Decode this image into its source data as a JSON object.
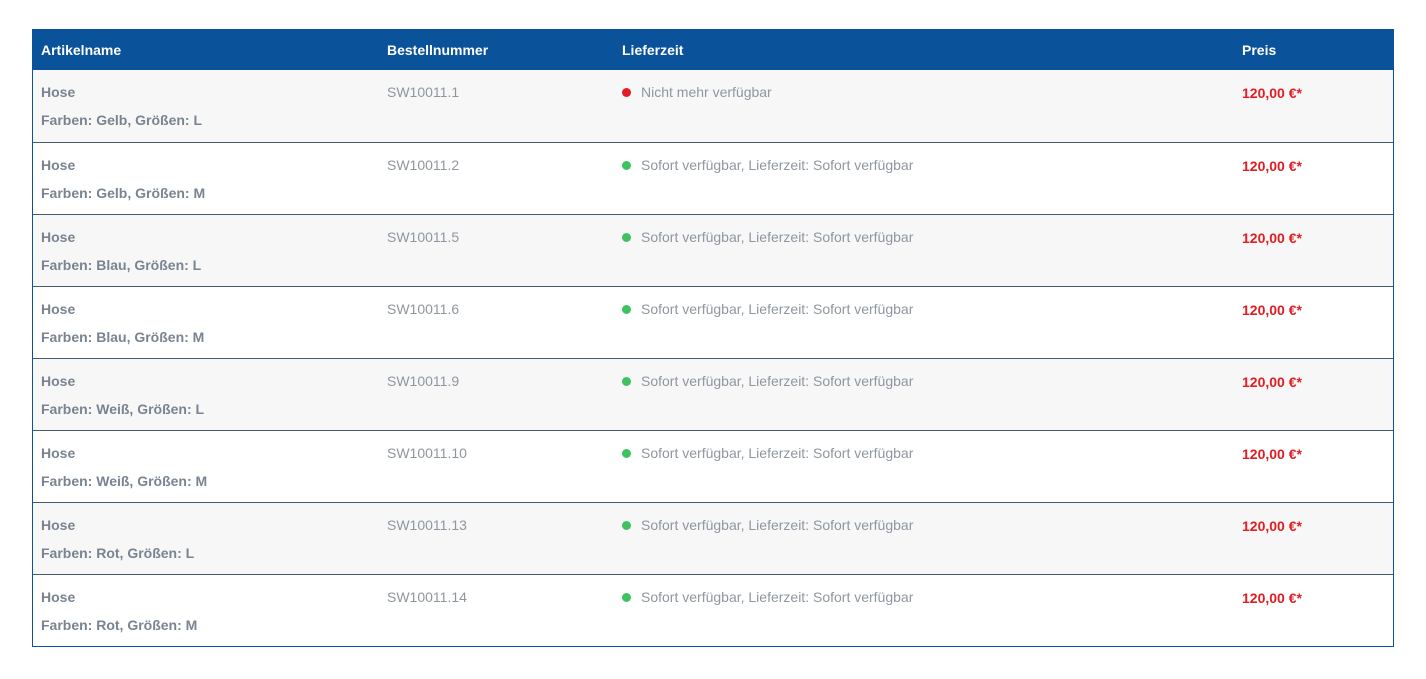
{
  "colors": {
    "header_bg": "#0a5299",
    "price": "#e21c23",
    "available": "#3cc261",
    "unavailable": "#e21c23"
  },
  "header": {
    "name": "Artikelname",
    "sku": "Bestellnummer",
    "delivery": "Lieferzeit",
    "price": "Preis"
  },
  "rows": [
    {
      "name": "Hose",
      "options": "Farben: Gelb, Größen: L",
      "sku": "SW10011.1",
      "status": "unavailable",
      "delivery": "Nicht mehr verfügbar",
      "price": "120,00 €*"
    },
    {
      "name": "Hose",
      "options": "Farben: Gelb, Größen: M",
      "sku": "SW10011.2",
      "status": "available",
      "delivery": "Sofort verfügbar, Lieferzeit: Sofort verfügbar",
      "price": "120,00 €*"
    },
    {
      "name": "Hose",
      "options": "Farben: Blau, Größen: L",
      "sku": "SW10011.5",
      "status": "available",
      "delivery": "Sofort verfügbar, Lieferzeit: Sofort verfügbar",
      "price": "120,00 €*"
    },
    {
      "name": "Hose",
      "options": "Farben: Blau, Größen: M",
      "sku": "SW10011.6",
      "status": "available",
      "delivery": "Sofort verfügbar, Lieferzeit: Sofort verfügbar",
      "price": "120,00 €*"
    },
    {
      "name": "Hose",
      "options": "Farben: Weiß, Größen: L",
      "sku": "SW10011.9",
      "status": "available",
      "delivery": "Sofort verfügbar, Lieferzeit: Sofort verfügbar",
      "price": "120,00 €*"
    },
    {
      "name": "Hose",
      "options": "Farben: Weiß, Größen: M",
      "sku": "SW10011.10",
      "status": "available",
      "delivery": "Sofort verfügbar, Lieferzeit: Sofort verfügbar",
      "price": "120,00 €*"
    },
    {
      "name": "Hose",
      "options": "Farben: Rot, Größen: L",
      "sku": "SW10011.13",
      "status": "available",
      "delivery": "Sofort verfügbar, Lieferzeit: Sofort verfügbar",
      "price": "120,00 €*"
    },
    {
      "name": "Hose",
      "options": "Farben: Rot, Größen: M",
      "sku": "SW10011.14",
      "status": "available",
      "delivery": "Sofort verfügbar, Lieferzeit: Sofort verfügbar",
      "price": "120,00 €*"
    }
  ]
}
